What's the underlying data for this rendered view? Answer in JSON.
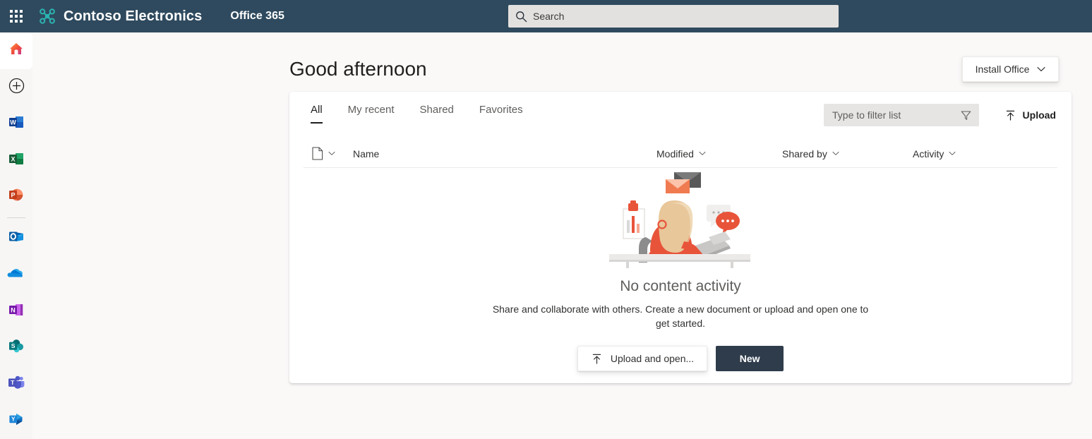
{
  "suite": {
    "waffle_name": "app-launcher",
    "brand_name": "Contoso Electronics",
    "brand_icon": "drone-logo-icon",
    "secondary_label": "Office 365",
    "search": {
      "placeholder": "Search",
      "value": "",
      "icon": "search-icon"
    },
    "colors": {
      "bar_background": "#2f4a5e",
      "brand_icon": "#2bb3b1",
      "text": "#ffffff",
      "search_background": "#e3e1df"
    }
  },
  "rail": {
    "items": [
      {
        "name": "home",
        "label": "Home",
        "icon": "home-icon",
        "active": true
      },
      {
        "name": "create-new",
        "label": "Create",
        "icon": "plus-circle-icon",
        "active": false
      },
      {
        "name": "word",
        "label": "Word",
        "icon": "word-icon",
        "active": false
      },
      {
        "name": "excel",
        "label": "Excel",
        "icon": "excel-icon",
        "active": false
      },
      {
        "name": "powerpoint",
        "label": "PowerPoint",
        "icon": "powerpoint-icon",
        "active": false
      },
      {
        "name": "outlook",
        "label": "Outlook",
        "icon": "outlook-icon",
        "active": false
      },
      {
        "name": "onedrive",
        "label": "OneDrive",
        "icon": "onedrive-icon",
        "active": false
      },
      {
        "name": "onenote",
        "label": "OneNote",
        "icon": "onenote-icon",
        "active": false
      },
      {
        "name": "sharepoint",
        "label": "SharePoint",
        "icon": "sharepoint-icon",
        "active": false
      },
      {
        "name": "teams",
        "label": "Teams",
        "icon": "teams-icon",
        "active": false
      },
      {
        "name": "yammer",
        "label": "Yammer",
        "icon": "yammer-icon",
        "active": false
      }
    ],
    "cursor_marker_color": "#d83b01"
  },
  "header": {
    "greeting": "Good afternoon",
    "install_office": {
      "label": "Install Office",
      "chevron_icon": "chevron-down-icon"
    }
  },
  "card": {
    "tabs": [
      {
        "label": "All",
        "active": true
      },
      {
        "label": "My recent",
        "active": false
      },
      {
        "label": "Shared",
        "active": false
      },
      {
        "label": "Favorites",
        "active": false
      }
    ],
    "filter": {
      "placeholder": "Type to filter list",
      "value": "",
      "icon": "filter-funnel-icon"
    },
    "upload": {
      "label": "Upload",
      "icon": "upload-arrow-icon"
    },
    "columns": [
      {
        "name": "file-type",
        "label": "",
        "icon": "document-icon",
        "has_chevron": true
      },
      {
        "name": "name",
        "label": "Name",
        "icon": "",
        "has_chevron": false
      },
      {
        "name": "modified",
        "label": "Modified",
        "icon": "",
        "has_chevron": true
      },
      {
        "name": "shared-by",
        "label": "Shared by",
        "icon": "",
        "has_chevron": true
      },
      {
        "name": "activity",
        "label": "Activity",
        "icon": "",
        "has_chevron": true
      }
    ],
    "rows": [],
    "empty_state": {
      "illustration": "person-at-desk-with-laptop-illustration",
      "title": "No content activity",
      "description": "Share and collaborate with others. Create a new document or upload and open one to get started.",
      "primary_button": {
        "label": "New"
      },
      "secondary_button": {
        "label": "Upload and open...",
        "icon": "upload-arrow-icon"
      }
    }
  },
  "theme": {
    "page_background": "#faf9f8",
    "card_background": "#ffffff",
    "rail_background": "#f7f6f5",
    "primary_button": "#2f3c4c",
    "divider": "#edebe9"
  }
}
